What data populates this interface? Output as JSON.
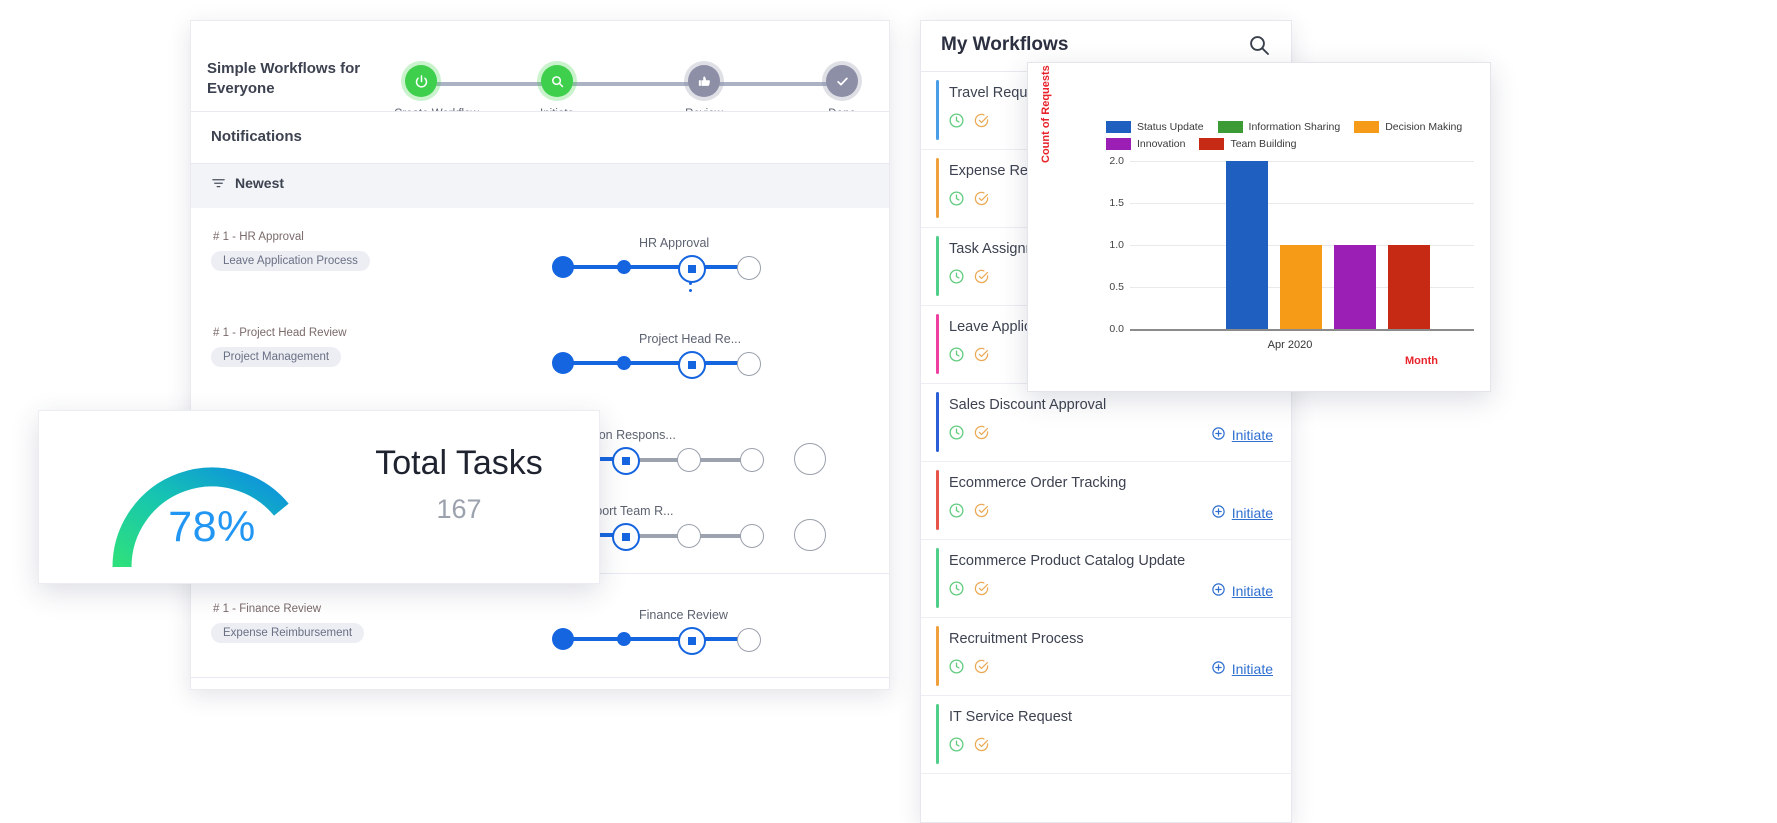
{
  "left_panel": {
    "stepper": {
      "title": "Simple Workflows for Everyone",
      "steps": [
        {
          "label": "Create Workflow",
          "icon": "power-icon",
          "state": "green"
        },
        {
          "label": "Initiate",
          "icon": "search-icon",
          "state": "green"
        },
        {
          "label": "Review",
          "icon": "thumbs-up-icon",
          "state": "grey"
        },
        {
          "label": "Done",
          "icon": "check-icon",
          "state": "grey"
        }
      ]
    },
    "notifications_title": "Notifications",
    "sort_label": "Newest",
    "rows": [
      {
        "id": "# 1 - HR Approval",
        "chip": "Leave Application Process",
        "stage": "HR Approval",
        "kind": "full"
      },
      {
        "id": "# 1 - Project Head Review",
        "chip": "Project Management",
        "stage": "Project Head Re...",
        "kind": "full"
      },
      {
        "id": "",
        "chip": "",
        "stage": "Person Respons...",
        "kind": "long"
      },
      {
        "id": "",
        "chip": "",
        "stage": "Support Team R...",
        "kind": "long"
      },
      {
        "id": "# 1 - Finance Review",
        "chip": "Expense Reimbursement",
        "stage": "Finance Review",
        "kind": "full"
      }
    ]
  },
  "gauge_card": {
    "percent": "78%",
    "title": "Total Tasks",
    "value": "167",
    "percent_number": 78,
    "color_start": "#22d58a",
    "color_end": "#0d8fe0"
  },
  "workflows_panel": {
    "title": "My Workflows",
    "search_icon": "search-icon",
    "initiate_label": "Initiate",
    "items": [
      {
        "name": "Travel Request",
        "color": "#4a9ee8",
        "initiate": false
      },
      {
        "name": "Expense Reimbursement",
        "color": "#f0a03c",
        "initiate": false
      },
      {
        "name": "Task Assignment",
        "color": "#4fd08a",
        "initiate": false
      },
      {
        "name": "Leave Application Process",
        "color": "#ef3fa0",
        "initiate": false
      },
      {
        "name": "Sales Discount Approval",
        "color": "#2a5fd6",
        "initiate": true
      },
      {
        "name": "Ecommerce Order Tracking",
        "color": "#e8544a",
        "initiate": true
      },
      {
        "name": "Ecommerce Product Catalog Update",
        "color": "#4fd08a",
        "initiate": true
      },
      {
        "name": "Recruitment Process",
        "color": "#f0a03c",
        "initiate": true
      },
      {
        "name": "IT Service Request",
        "color": "#4fd08a",
        "initiate": false
      }
    ]
  },
  "chart_data": {
    "type": "bar",
    "title": "",
    "categories": [
      "Apr 2020"
    ],
    "series": [
      {
        "name": "Status Update",
        "color": "#1f5fbf",
        "values": [
          2.0
        ]
      },
      {
        "name": "Information Sharing",
        "color": "#3c9b35",
        "values": [
          0
        ]
      },
      {
        "name": "Decision Making",
        "color": "#f59b18",
        "values": [
          1.0
        ]
      },
      {
        "name": "Innovation",
        "color": "#9b1fb5",
        "values": [
          1.0
        ]
      },
      {
        "name": "Team Building",
        "color": "#c62a14",
        "values": [
          1.0
        ]
      }
    ],
    "xlabel": "Month",
    "ylabel": "Count of Requests",
    "ylim": [
      0.0,
      2.0
    ],
    "yticks": [
      "0.0",
      "0.5",
      "1.0",
      "1.5",
      "2.0"
    ],
    "xticks": [
      "Apr 2020"
    ],
    "grid": true,
    "legend_position": "top"
  }
}
